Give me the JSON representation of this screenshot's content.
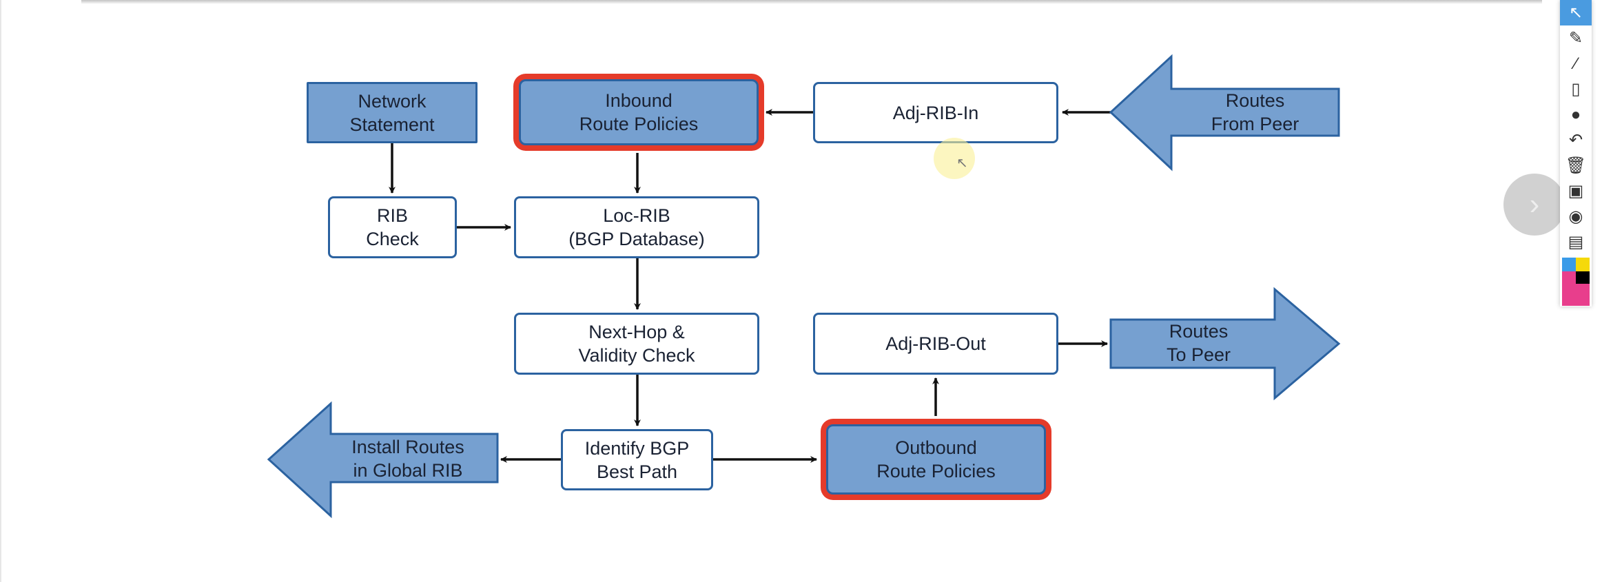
{
  "diagram": {
    "nodes": {
      "network_statement": "Network\nStatement",
      "inbound_policies": "Inbound\nRoute Policies",
      "adj_rib_in": "Adj-RIB-In",
      "routes_from_peer": "Routes\nFrom Peer",
      "rib_check": "RIB\nCheck",
      "loc_rib": "Loc-RIB\n(BGP Database)",
      "next_hop": "Next-Hop &\nValidity Check",
      "adj_rib_out": "Adj-RIB-Out",
      "routes_to_peer": "Routes\nTo Peer",
      "install_routes": "Install Routes\nin Global RIB",
      "best_path": "Identify BGP\nBest Path",
      "outbound_policies": "Outbound\nRoute Policies"
    },
    "colors": {
      "fill": "#76a0d0",
      "border": "#2b62a0",
      "highlight": "#e53b2a"
    }
  },
  "toolbar": {
    "tools": [
      "cursor-icon",
      "pen-icon",
      "line-icon",
      "eraser-icon",
      "dot-icon",
      "undo-icon",
      "trash-icon",
      "presenter-icon",
      "camera-icon",
      "clipboard-icon"
    ],
    "palette": [
      "#3a9be8",
      "#f5d90a",
      "#e83e8c",
      "#000000"
    ]
  },
  "nav": {
    "next_icon": "chevron-right-icon"
  }
}
